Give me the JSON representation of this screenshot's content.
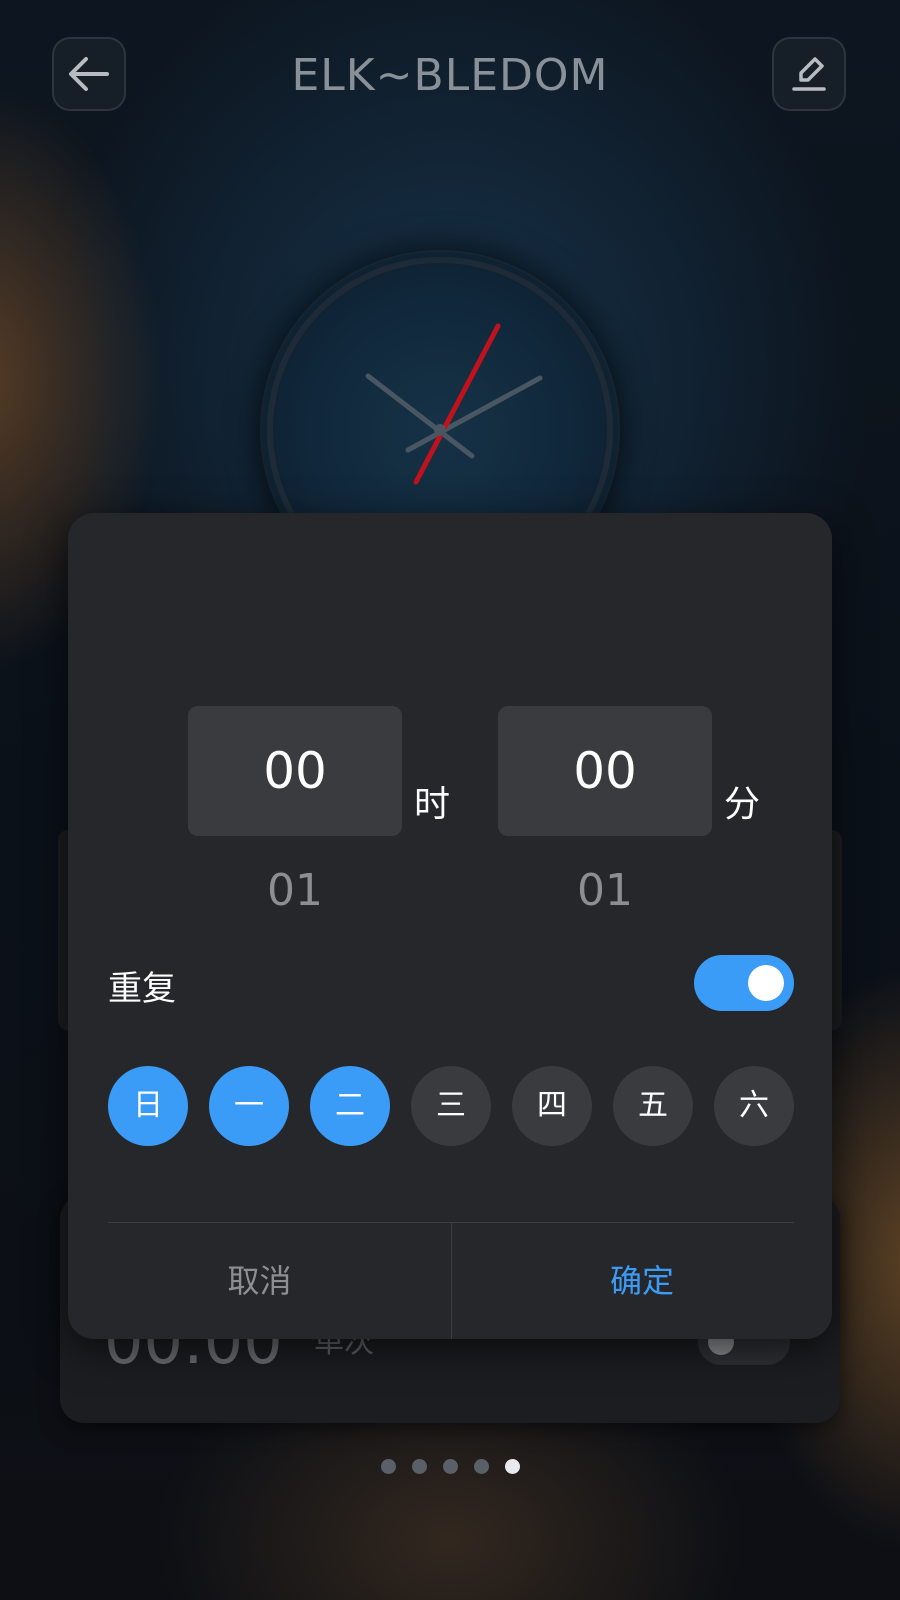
{
  "header": {
    "title": "ELK~BLEDOM",
    "back_icon": "arrow-left-icon",
    "edit_icon": "pencil-icon"
  },
  "background_card": {
    "time": "00:00",
    "mode": "单次",
    "toggle_on": false
  },
  "pager": {
    "count": 5,
    "active_index": 4
  },
  "dialog": {
    "hour": {
      "value": "00",
      "unit": "时",
      "next": "01"
    },
    "minute": {
      "value": "00",
      "unit": "分",
      "next": "01"
    },
    "repeat": {
      "label": "重复",
      "enabled": true
    },
    "days": [
      {
        "label": "日",
        "selected": true
      },
      {
        "label": "一",
        "selected": true
      },
      {
        "label": "二",
        "selected": true
      },
      {
        "label": "三",
        "selected": false
      },
      {
        "label": "四",
        "selected": false
      },
      {
        "label": "五",
        "selected": false
      },
      {
        "label": "六",
        "selected": false
      }
    ],
    "cancel_label": "取消",
    "confirm_label": "确定"
  },
  "colors": {
    "accent": "#3b9cf8",
    "dialog_bg": "#26272b",
    "clock_second_hand": "#c0121c"
  }
}
